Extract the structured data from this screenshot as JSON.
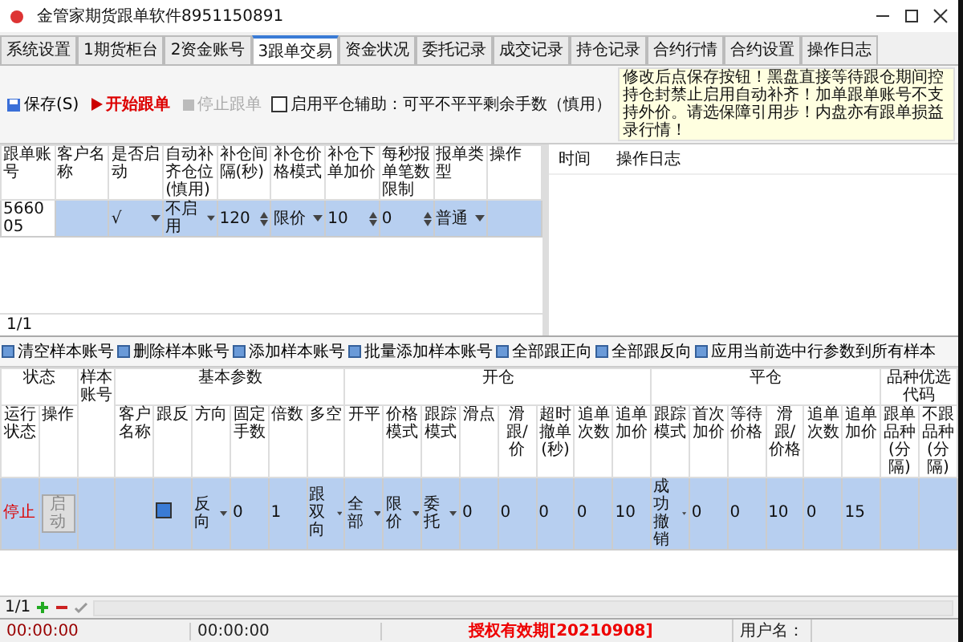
{
  "window": {
    "title": "金管家期货跟单软件8951150891"
  },
  "tabs": [
    {
      "label": "系统设置",
      "selected": false
    },
    {
      "label": "1期货柜台",
      "selected": false
    },
    {
      "label": "2资金账号",
      "selected": false
    },
    {
      "label": "3跟单交易",
      "selected": true
    },
    {
      "label": "资金状况",
      "selected": false
    },
    {
      "label": "委托记录",
      "selected": false
    },
    {
      "label": "成交记录",
      "selected": false
    },
    {
      "label": "持仓记录",
      "selected": false
    },
    {
      "label": "合约行情",
      "selected": false
    },
    {
      "label": "合约设置",
      "selected": false
    },
    {
      "label": "操作日志",
      "selected": false
    }
  ],
  "toolbar": {
    "save": "保存(S)",
    "start": "开始跟单",
    "stop": {
      "label": "停止跟单",
      "disabled": true
    },
    "close_assist": {
      "label": "启用平仓辅助：可平不平平剩余手数（慎用）",
      "checked": false
    },
    "notice": "修改后点保存按钮！黑盘直接等待跟仓期间控持仓封禁止启用自动补齐！加单跟单账号不支持外价。请选保障引用步！内盘亦有跟单损益录行情！"
  },
  "follow_table": {
    "columns": [
      "跟单账号",
      "客户名称",
      "是否启动",
      "自动补齐仓位(慎用)",
      "补仓间隔(秒)",
      "补仓价格模式",
      "补仓下单加价",
      "每秒报单笔数限制",
      "报单类型",
      "操作"
    ],
    "rows": [
      {
        "cells": [
          {
            "kind": "text",
            "value": "566005"
          },
          {
            "kind": "blank"
          },
          {
            "kind": "select",
            "value": "√"
          },
          {
            "kind": "select",
            "value": "不启用"
          },
          {
            "kind": "spin",
            "value": "120"
          },
          {
            "kind": "select",
            "value": "限价"
          },
          {
            "kind": "spin",
            "value": "10"
          },
          {
            "kind": "spin",
            "value": "0"
          },
          {
            "kind": "select",
            "value": "普通"
          },
          {
            "kind": "blank"
          }
        ]
      }
    ]
  },
  "follow_pager": "1/1",
  "log": {
    "columns": [
      "时间",
      "操作日志"
    ]
  },
  "sample_toolbar": [
    "清空样本账号",
    "删除样本账号",
    "添加样本账号",
    "批量添加样本账号",
    "全部跟正向",
    "全部跟反向",
    "应用当前选中行参数到所有样本"
  ],
  "sample_table": {
    "groups": [
      {
        "label": "状态",
        "columns": [
          "运行状态",
          "操作"
        ]
      },
      {
        "columns": [
          "样本账号"
        ]
      },
      {
        "label": "基本参数",
        "columns": [
          "客户名称",
          "跟反",
          "方向",
          "固定手数",
          "倍数",
          "多空"
        ]
      },
      {
        "label": "开仓",
        "columns": [
          "开平",
          "价格模式",
          "跟踪模式",
          "滑点",
          "滑跟/价",
          "超时撤单(秒)",
          "追单次数",
          "追单加价"
        ]
      },
      {
        "label": "平仓",
        "columns": [
          "跟踪模式",
          "首次加价",
          "等待价格",
          "滑跟/价格",
          "追单次数",
          "追单加价"
        ]
      },
      {
        "label": "品种优选代码",
        "columns": [
          "跟单品种(分隔)",
          "不跟品种(分隔)"
        ]
      }
    ],
    "rows": [
      {
        "cells": [
          {
            "kind": "status",
            "value": "停止"
          },
          {
            "kind": "button",
            "value": "启动"
          },
          {
            "kind": "blank"
          },
          {
            "kind": "blank"
          },
          {
            "kind": "check",
            "checked": true
          },
          {
            "kind": "select",
            "value": "反向"
          },
          {
            "kind": "spin",
            "value": "0"
          },
          {
            "kind": "spin",
            "value": "1"
          },
          {
            "kind": "select",
            "value": "跟双向"
          },
          {
            "kind": "select",
            "value": "全部"
          },
          {
            "kind": "select",
            "value": "限价"
          },
          {
            "kind": "select",
            "value": "委托"
          },
          {
            "kind": "spin",
            "value": "0"
          },
          {
            "kind": "spin",
            "value": "0"
          },
          {
            "kind": "spin",
            "value": "0"
          },
          {
            "kind": "spin",
            "value": "0"
          },
          {
            "kind": "spin",
            "value": "10"
          },
          {
            "kind": "select",
            "value": "成功撤销"
          },
          {
            "kind": "spin",
            "value": "0"
          },
          {
            "kind": "spin",
            "value": "0"
          },
          {
            "kind": "spin",
            "value": "10"
          },
          {
            "kind": "spin",
            "value": "0"
          },
          {
            "kind": "spin",
            "value": "15"
          },
          {
            "kind": "blank"
          },
          {
            "kind": "blank"
          }
        ]
      }
    ]
  },
  "sample_pager": "1/1",
  "status_bar": [
    {
      "kind": "time",
      "text": "00:00:00"
    },
    {
      "kind": "plain",
      "text": "00:00:00"
    },
    {
      "kind": "alert",
      "text": "授权有效期[20210908]"
    },
    {
      "kind": "plain",
      "text": "用户名："
    }
  ]
}
